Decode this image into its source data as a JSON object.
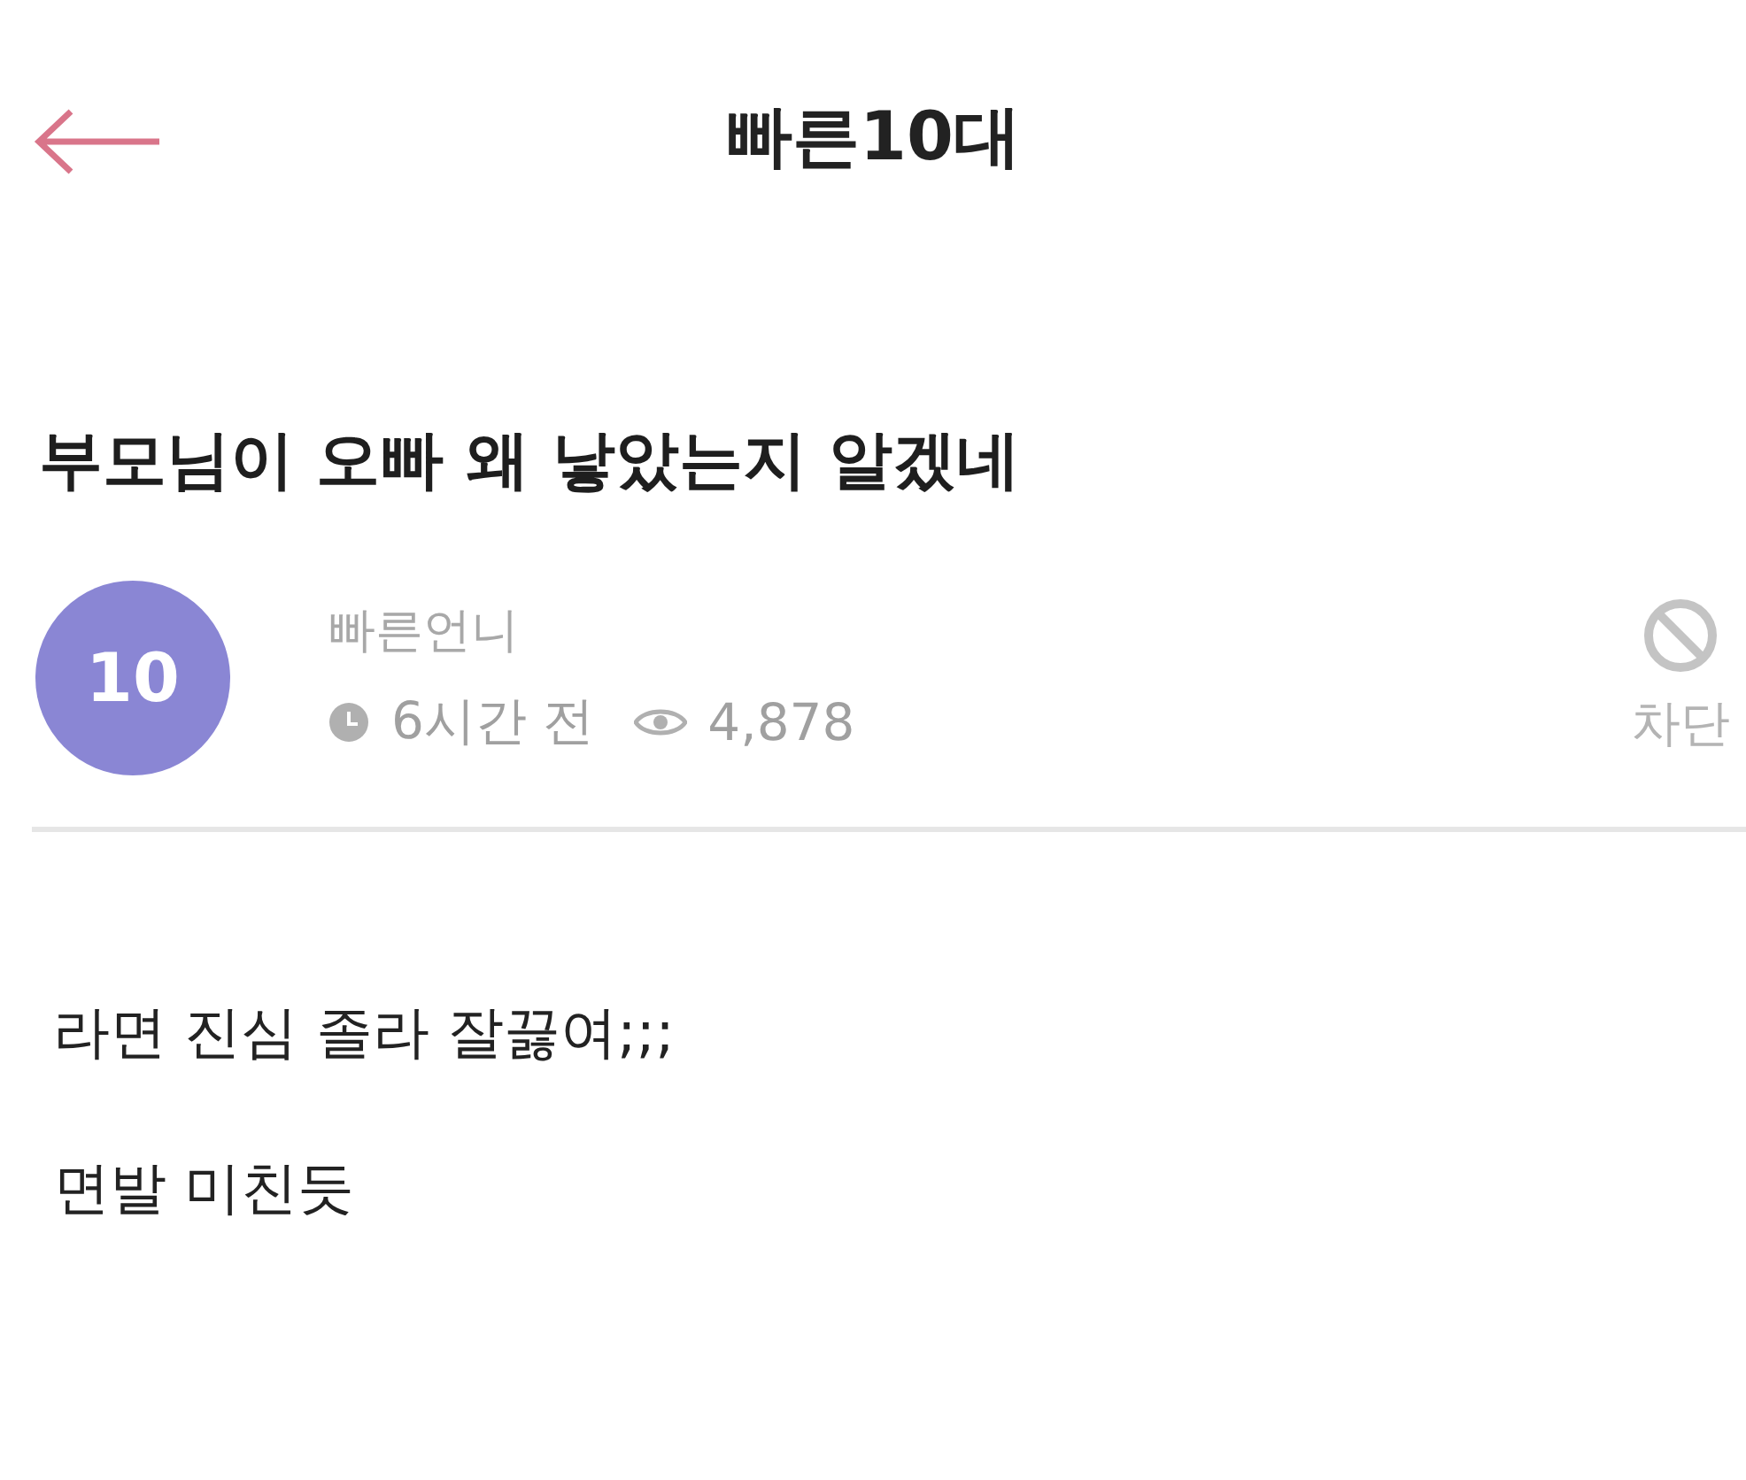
{
  "header": {
    "title": "빠른10대"
  },
  "post": {
    "title": "부모님이 오빠 왜 낳았는지 알겠네",
    "author": {
      "avatar_text": "10",
      "name": "빠른언니",
      "time": "6시간 전",
      "views": "4,878"
    },
    "block_label": "차단",
    "body": [
      "라면 진심 졸라 잘끓여;;;",
      "면발 미친듯"
    ]
  }
}
